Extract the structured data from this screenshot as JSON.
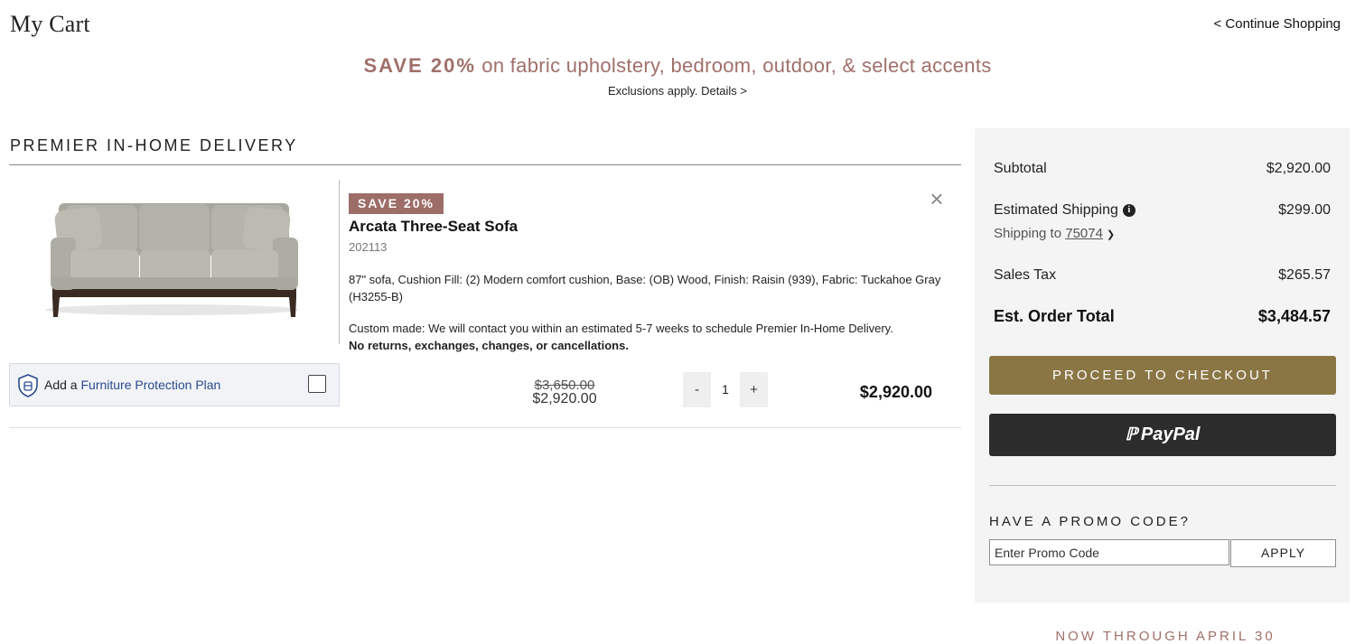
{
  "header": {
    "title": "My Cart",
    "continue_label": "< Continue Shopping"
  },
  "promo_banner": {
    "headline_strong": "SAVE 20%",
    "headline_rest": " on fabric upholstery, bedroom, outdoor, & select accents",
    "subtext": "Exclusions apply. Details >"
  },
  "delivery_section": {
    "title": "PREMIER IN-HOME DELIVERY"
  },
  "item": {
    "badge": "SAVE 20%",
    "name": "Arcata Three-Seat Sofa",
    "sku": "202113",
    "description": "87\" sofa, Cushion Fill: (2) Modern comfort cushion, Base: (OB) Wood, Finish: Raisin (939), Fabric: Tuckahoe Gray (H3255-B)",
    "custom_note": "Custom made: We will contact you within an estimated 5-7 weeks to schedule Premier In-Home Delivery.",
    "policy_note": "No returns, exchanges, changes, or cancellations.",
    "original_price": "$3,650.00",
    "sale_price": "$2,920.00",
    "quantity": "1",
    "qty_minus": "-",
    "qty_plus": "+",
    "line_total": "$2,920.00",
    "remove_symbol": "×",
    "image_icon": "sofa-image"
  },
  "protection_plan": {
    "prefix": "Add a ",
    "link": "Furniture Protection Plan",
    "checked": false,
    "icon": "shield-icon"
  },
  "summary": {
    "subtotal_label": "Subtotal",
    "subtotal_value": "$2,920.00",
    "shipping_label": "Estimated Shipping",
    "shipping_value": "$299.00",
    "shipping_to_label": "Shipping to ",
    "zip": "75074",
    "tax_label": "Sales Tax",
    "tax_value": "$265.57",
    "total_label": "Est. Order Total",
    "total_value": "$3,484.57",
    "checkout_label": "PROCEED TO CHECKOUT",
    "paypal_label": "PayPal",
    "promo_title": "HAVE A PROMO CODE?",
    "promo_placeholder": "Enter Promo Code",
    "apply_label": "APPLY"
  },
  "footer_promo": "NOW THROUGH APRIL 30",
  "colors": {
    "promo_accent": "#a0706a",
    "badge_bg": "#9d6d68",
    "checkout_bg": "#8a7645",
    "paypal_bg": "#2c2c2c",
    "summary_bg": "#f4f4f4",
    "link_blue": "#2a4a8e"
  }
}
